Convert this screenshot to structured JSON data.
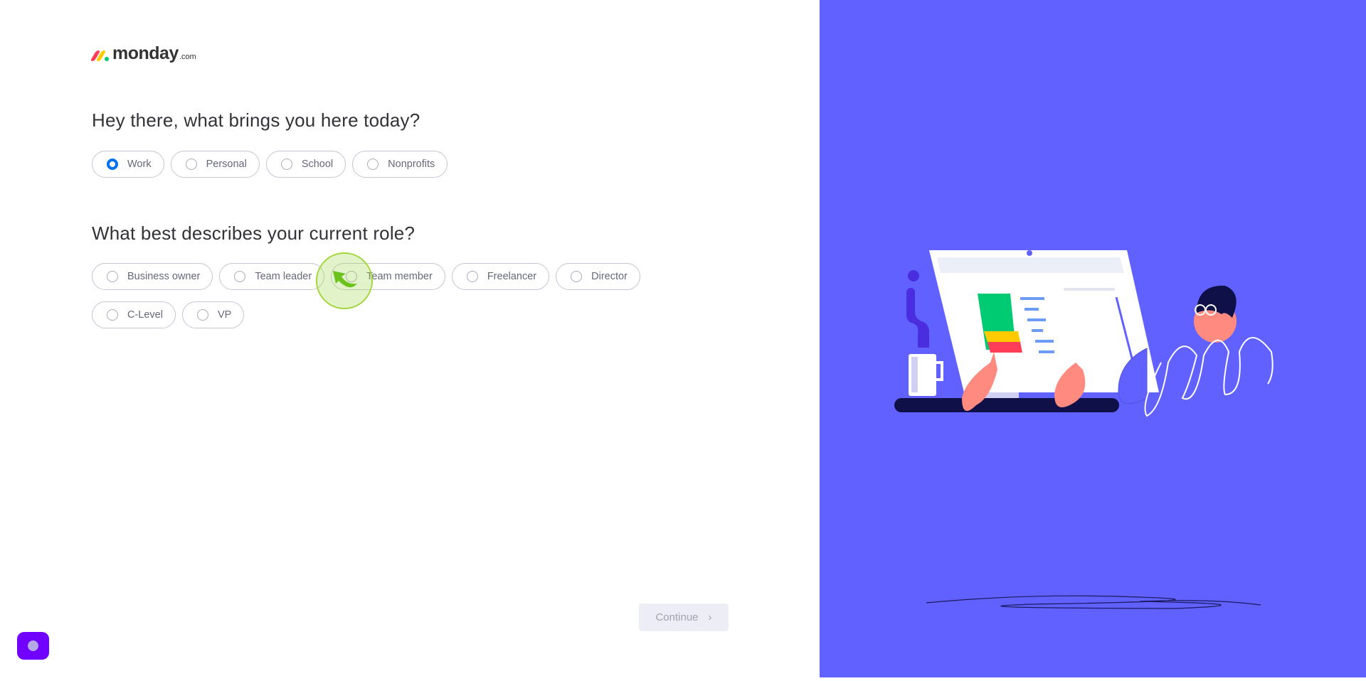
{
  "brand": {
    "name": "monday",
    "suffix": ".com",
    "colors": [
      "#ff3d57",
      "#ffcb00",
      "#00ca72"
    ]
  },
  "q1": {
    "title": "Hey there, what brings you here today?",
    "options": [
      {
        "label": "Work",
        "selected": true
      },
      {
        "label": "Personal",
        "selected": false
      },
      {
        "label": "School",
        "selected": false
      },
      {
        "label": "Nonprofits",
        "selected": false
      }
    ]
  },
  "q2": {
    "title": "What best describes your current role?",
    "options": [
      {
        "label": "Business owner",
        "selected": false
      },
      {
        "label": "Team leader",
        "selected": false
      },
      {
        "label": "Team member",
        "selected": false
      },
      {
        "label": "Freelancer",
        "selected": false
      },
      {
        "label": "Director",
        "selected": false
      },
      {
        "label": "C-Level",
        "selected": false
      },
      {
        "label": "VP",
        "selected": false
      }
    ]
  },
  "footer": {
    "continue_label": "Continue",
    "continue_icon": "chevron-right-icon",
    "chat_icon": "chat-icon"
  },
  "colors": {
    "accent": "#0073ea",
    "panel": "#6161ff",
    "chat": "#7000ff"
  }
}
